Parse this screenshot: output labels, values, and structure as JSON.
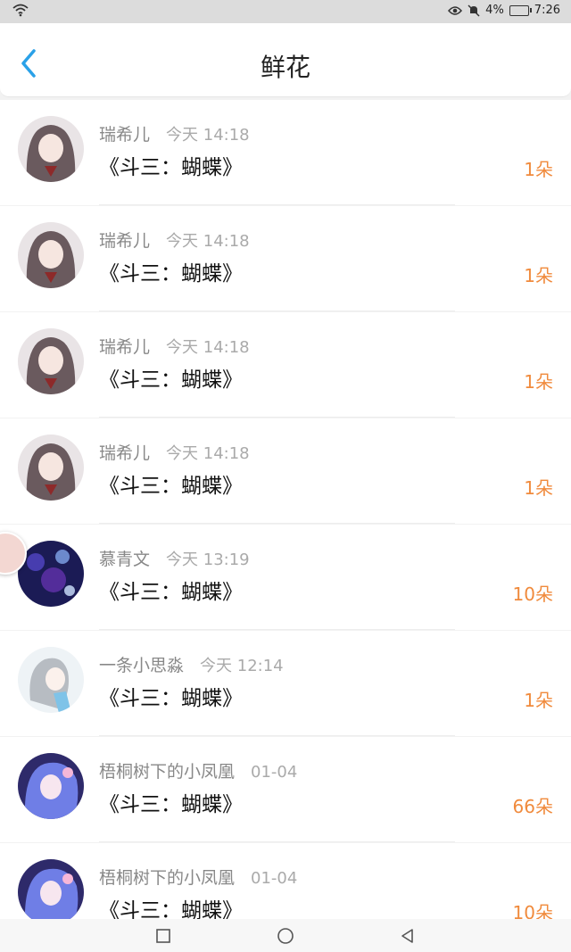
{
  "status_bar": {
    "battery": "4%",
    "time": "7:26"
  },
  "header": {
    "title": "鲜花"
  },
  "items": [
    {
      "user": "瑞希儿",
      "time": "今天 14:18",
      "work": "《斗三：蝴蝶》",
      "count": "1朵",
      "avatar": "anime-girl-dark-hair"
    },
    {
      "user": "瑞希儿",
      "time": "今天 14:18",
      "work": "《斗三：蝴蝶》",
      "count": "1朵",
      "avatar": "anime-girl-dark-hair"
    },
    {
      "user": "瑞希儿",
      "time": "今天 14:18",
      "work": "《斗三：蝴蝶》",
      "count": "1朵",
      "avatar": "anime-girl-dark-hair"
    },
    {
      "user": "瑞希儿",
      "time": "今天 14:18",
      "work": "《斗三：蝴蝶》",
      "count": "1朵",
      "avatar": "anime-girl-dark-hair"
    },
    {
      "user": "慕青文",
      "time": "今天 13:19",
      "work": "《斗三：蝴蝶》",
      "count": "10朵",
      "avatar": "blue-night-lights"
    },
    {
      "user": "一条小思淼",
      "time": "今天 12:14",
      "work": "《斗三：蝴蝶》",
      "count": "1朵",
      "avatar": "sketch-girl-white"
    },
    {
      "user": "梧桐树下的小凤凰",
      "time": "01-04",
      "work": "《斗三：蝴蝶》",
      "count": "66朵",
      "avatar": "anime-girl-blue-hair"
    },
    {
      "user": "梧桐树下的小凤凰",
      "time": "01-04",
      "work": "《斗三：蝴蝶》",
      "count": "10朵",
      "avatar": "anime-girl-blue-hair"
    }
  ],
  "colors": {
    "accent": "#2aa1e8",
    "count": "#f08a3c"
  }
}
